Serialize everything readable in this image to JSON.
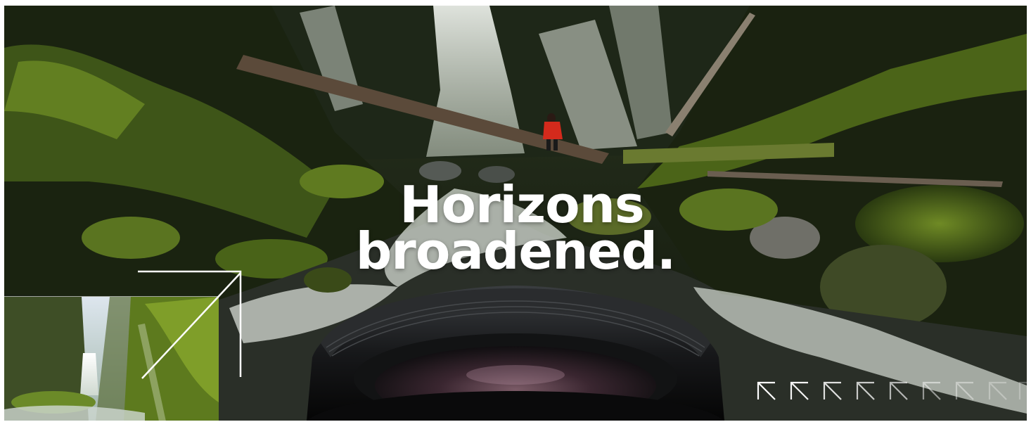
{
  "headline": {
    "line1": "Horizons",
    "line2": "broadened."
  },
  "colors": {
    "text": "#ffffff",
    "moss": "#4f6a1c",
    "jacket": "#d42a1c"
  }
}
